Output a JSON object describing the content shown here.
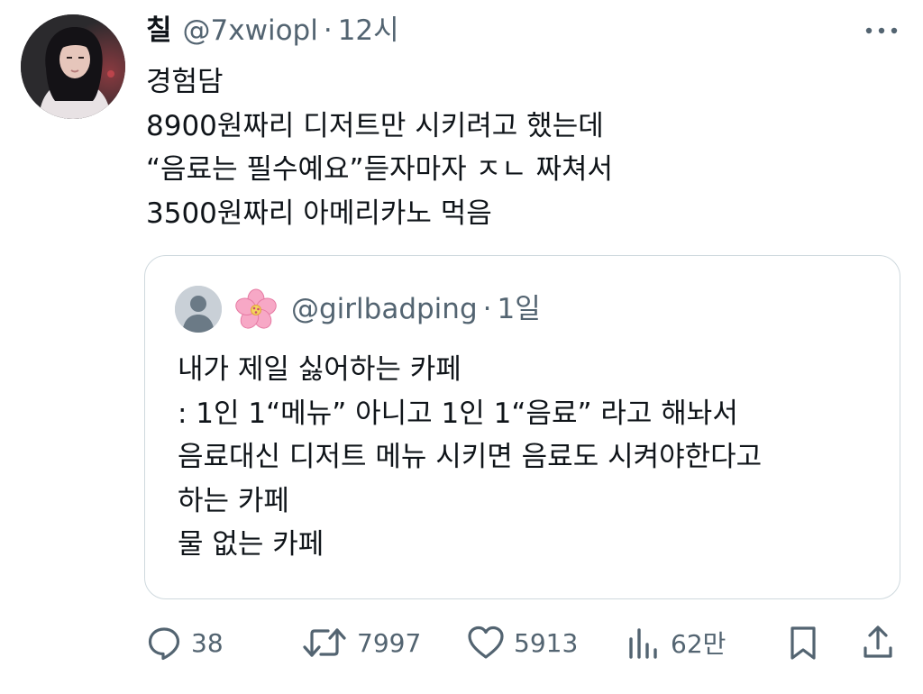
{
  "tweet": {
    "display_name": "칠",
    "handle": "@7xwiopl",
    "separator": "·",
    "time": "12시",
    "text_lines": [
      "경험담",
      "8900원짜리 디저트만 시키려고 했는데",
      "“음료는 필수예요”듣자마자 ㅈㄴ 짜쳐서",
      "3500원짜리 아메리카노 먹음"
    ]
  },
  "quote": {
    "handle": "@girlbadping",
    "separator": "·",
    "time": "1일",
    "text_lines": [
      "내가 제일 싫어하는 카페",
      ": 1인 1“메뉴” 아니고 1인 1“음료” 라고 해놔서",
      "음료대신 디저트 메뉴 시키면 음료도 시켜야한다고",
      "하는 카페",
      "물 없는 카페"
    ]
  },
  "actions": {
    "replies": "38",
    "retweets": "7997",
    "likes": "5913",
    "views": "62만"
  },
  "colors": {
    "text": "#0f1419",
    "secondary": "#536471",
    "border": "#cfd9de"
  }
}
